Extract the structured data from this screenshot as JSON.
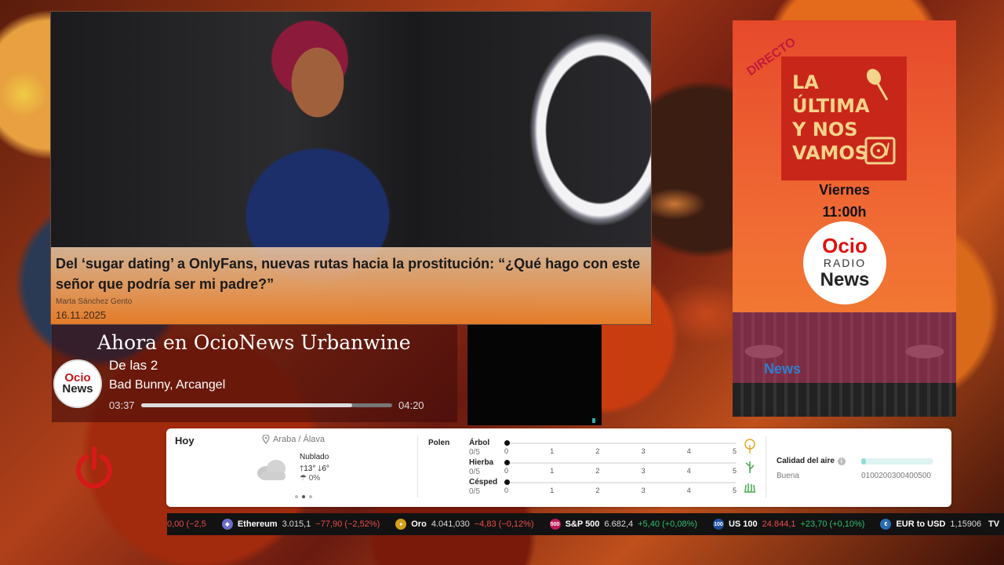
{
  "article": {
    "title": "Del ‘sugar dating’ a OnlyFans, nuevas rutas hacia la prostitución: “¿Qué hago con este señor que podría ser mi padre?”",
    "author": "Marta Sánchez Gento",
    "date": "16.11.2025"
  },
  "now_playing": {
    "header": "Ahora en OcioNews Urbanwine",
    "logo_line1": "Ocio",
    "logo_line2": "News",
    "song": "De las 2",
    "artist": "Bad Bunny, Arcangel",
    "time_elapsed": "03:37",
    "time_total": "04:20",
    "progress": 0.84
  },
  "radio_ad": {
    "badge": "DIRECTO",
    "title_lines": [
      "LA",
      "ÚLTIMA",
      "Y NOS",
      "VAMOS"
    ],
    "day": "Viernes",
    "time": "11:00h",
    "logo_ocio": "Ocio",
    "logo_radio": "RADIO",
    "logo_news": "News",
    "footer_news": "News"
  },
  "weather": {
    "today_label": "Hoy",
    "location": "Araba / Álava",
    "condition": "Nublado",
    "temp_max": "13°",
    "temp_min": "6°",
    "rain": "0%",
    "polen_label": "Polen",
    "polen": [
      {
        "name": "Árbol",
        "score": "0/5",
        "value": 0,
        "icon": "tree-icon",
        "color": "#e6a21f"
      },
      {
        "name": "Hierba",
        "score": "0/5",
        "value": 0,
        "icon": "grass-icon",
        "color": "#4caf50"
      },
      {
        "name": "Césped",
        "score": "0/5",
        "value": 0,
        "icon": "lawn-icon",
        "color": "#4caf50"
      }
    ],
    "polen_ticks": [
      "0",
      "1",
      "2",
      "3",
      "4",
      "5"
    ],
    "air_quality_label": "Calidad del aire",
    "air_quality_value": "Buena",
    "air_quality_scale": "0100200300400500"
  },
  "ticker": [
    {
      "name": "",
      "price": "",
      "change": "0,00 (−2,5",
      "dir": "neg",
      "icon": "",
      "icon_color": ""
    },
    {
      "name": "Ethereum",
      "price": "3.015,1",
      "change": "−77,90 (−2,52%)",
      "dir": "neg",
      "icon": "ethereum-icon",
      "icon_color": "#6b6fc8"
    },
    {
      "name": "Oro",
      "price": "4.041,030",
      "change": "−4,83 (−0,12%)",
      "dir": "neg",
      "icon": "gold-icon",
      "icon_color": "#d4a017"
    },
    {
      "name": "S&P 500",
      "price": "6.682,4",
      "change": "+5,40 (+0,08%)",
      "dir": "pos",
      "icon": "sp500-icon",
      "icon_color": "#c2185b",
      "badge": "500"
    },
    {
      "name": "US 100",
      "price": "24.844,1",
      "change": "+23,70 (+0,10%)",
      "dir": "pos",
      "icon": "us100-icon",
      "icon_color": "#1e4fa0",
      "badge": "100"
    },
    {
      "name": "EUR to USD",
      "price": "1,15906",
      "change": "",
      "dir": "pos",
      "icon": "eur-usd-icon",
      "icon_color": "#2b6cb0"
    }
  ],
  "ticker_brand": "TV"
}
